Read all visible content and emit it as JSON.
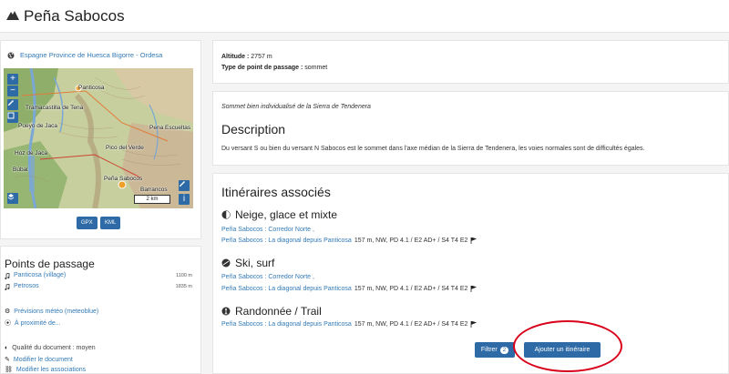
{
  "header": {
    "title": "Peña Sabocos"
  },
  "location": {
    "text": "Espagne Province de Huesca Bigorre - Ordesa"
  },
  "map": {
    "labels": [
      "Panticosa",
      "Tramacastilla de Tena",
      "Pueyo de Jaca",
      "Pico del Verde",
      "Hoz de Jaca",
      "Búbal",
      "Peña Sabocos",
      "Pena Escueltas",
      "Barrancos"
    ],
    "scale": "2 km"
  },
  "downloads": {
    "gpx": "GPX",
    "kml": "KML"
  },
  "info": {
    "altitude_label": "Altitude :",
    "altitude_value": "2757",
    "altitude_unit": "m",
    "type_label": "Type de point de passage :",
    "type_value": "sommet"
  },
  "summary": "Sommet bien individualisé de la Sierra de Tendenera",
  "description": {
    "title": "Description",
    "text": "Du versant S ou bien du versant N Sabocos est le sommet dans l'axe médian de la Sierra de Tendenera, les voies normales sont de difficultés égales."
  },
  "itineraries": {
    "title": "Itinéraires associés",
    "activities": [
      {
        "name": "Neige, glace et mixte",
        "icon": "snow-ice-mixed-icon",
        "routes": [
          {
            "link": "Peña Sabocos : Corredor Norte ,",
            "meta": ""
          },
          {
            "link": "Peña Sabocos : La diagonal depuis Panticosa",
            "meta": "157 m, NW, PD 4.1 / E2 AD+ / S4 T4 E2"
          }
        ]
      },
      {
        "name": "Ski, surf",
        "icon": "ski-icon",
        "routes": [
          {
            "link": "Peña Sabocos : Corredor Norte ,",
            "meta": ""
          },
          {
            "link": "Peña Sabocos : La diagonal depuis Panticosa",
            "meta": "157 m, NW, PD 4.1 / E2 AD+ / S4 T4 E2"
          }
        ]
      },
      {
        "name": "Randonnée / Trail",
        "icon": "hiking-icon",
        "routes": [
          {
            "link": "Peña Sabocos : La diagonal depuis Panticosa",
            "meta": "157 m, NW, PD 4.1 / E2 AD+ / S4 T4 E2"
          }
        ]
      }
    ],
    "filter_label": "Filtrer",
    "filter_count": "2",
    "add_label": "Ajouter un itinéraire"
  },
  "waypoints": {
    "title": "Points de passage",
    "items": [
      {
        "name": "Panticosa (village)",
        "alt": "1100 m"
      },
      {
        "name": "Petrosos",
        "alt": "1835 m"
      }
    ]
  },
  "links": {
    "weather": "Prévisions météo (meteoblue)",
    "nearby": "À proximité de...",
    "quality": "Qualité du document : moyen",
    "edit": "Modifier le document",
    "associations": "Modifier les associations"
  },
  "colors": {
    "accent": "#2d6aa6",
    "link": "#337ab7",
    "highlight": "#d9001b"
  }
}
